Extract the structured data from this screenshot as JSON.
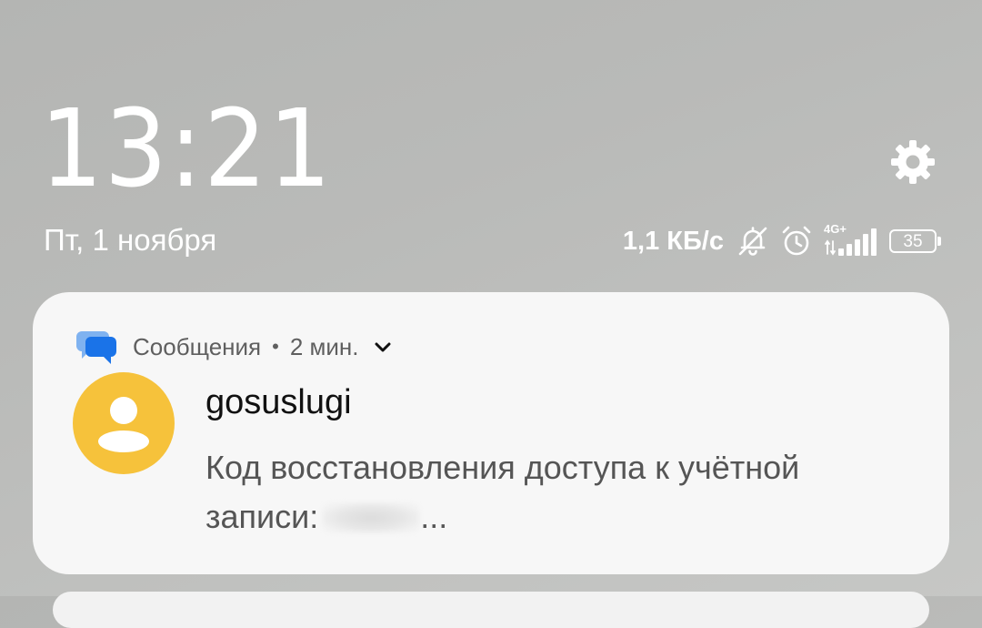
{
  "lockscreen": {
    "time": "13:21",
    "date": "Пт, 1 ноября"
  },
  "status_bar": {
    "net_speed": "1,1 КБ/с",
    "network_type": "4G+",
    "battery_level": "35",
    "icons": [
      "bell-off-icon",
      "alarm-icon",
      "signal-icon",
      "battery-icon"
    ]
  },
  "notification": {
    "app_name": "Сообщения",
    "separator": "•",
    "time_ago": "2 мин.",
    "sender": "gosuslugi",
    "message_prefix": "Код восстановления доступа к учётной записи:",
    "message_suffix": "..."
  },
  "colors": {
    "avatar": "#f6c23b",
    "app_icon": "#1a73e8",
    "card": "#f7f7f7"
  }
}
